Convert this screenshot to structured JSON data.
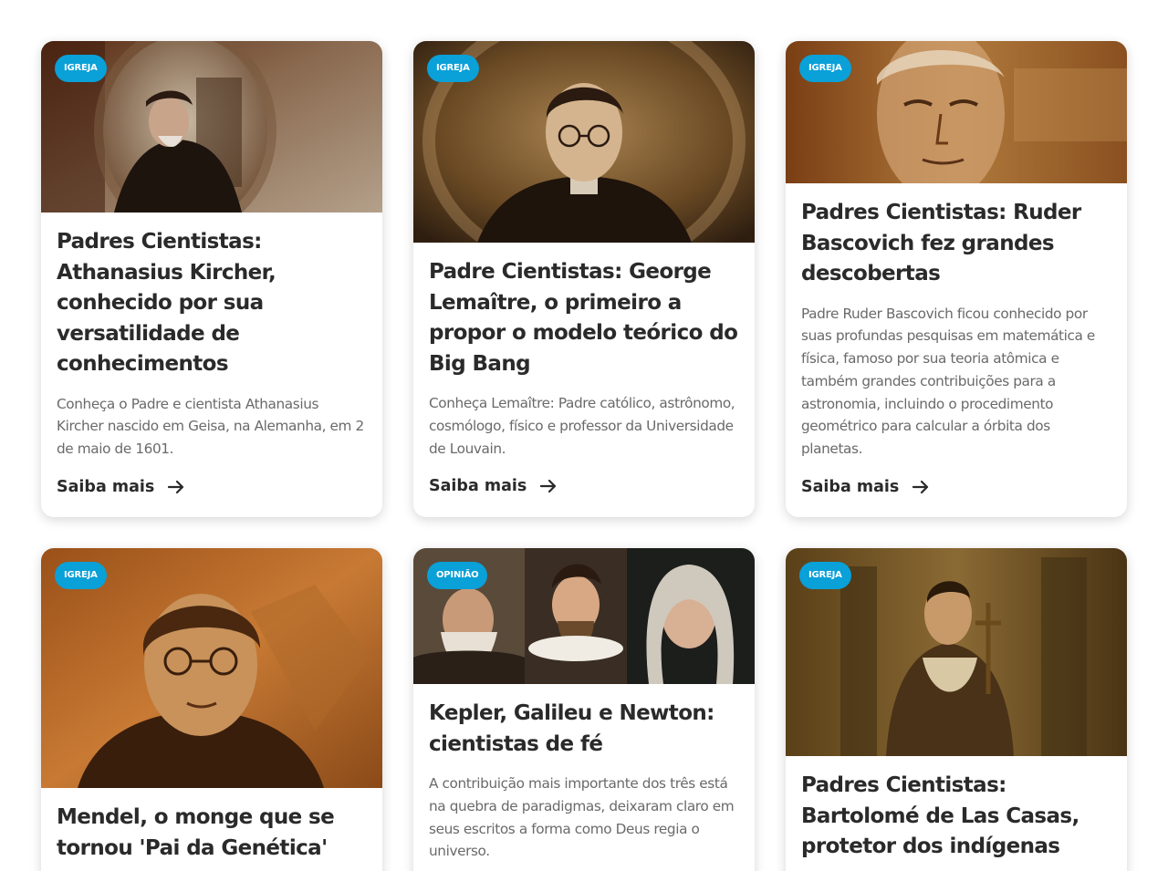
{
  "cards": [
    {
      "badge": "IGREJA",
      "title": "Padres Cientistas: Athanasius Kircher, conhecido por sua versatilidade de conhecimentos",
      "description": "Conheça o Padre e cientista Athanasius Kircher nascido em Geisa, na Alemanha, em 2 de maio de 1601.",
      "link": "Saiba mais",
      "image": "athanasius-kircher-portrait"
    },
    {
      "badge": "IGREJA",
      "title": "Padre Cientistas: George Lemaître, o primeiro a propor o modelo teórico do Big Bang",
      "description": "Conheça Lemaître: Padre católico, astrônomo, cosmólogo, físico e professor da Universidade de Louvain.",
      "link": "Saiba mais",
      "image": "george-lemaitre-portrait"
    },
    {
      "badge": "IGREJA",
      "title": "Padres Cientistas: Ruder Bascovich fez grandes descobertas",
      "description": "Padre Ruder Bascovich ficou conhecido por suas profundas pesquisas em matemática e física, famoso por sua teoria atômica e também grandes contribuições para a astronomia, incluindo o procedimento geométrico para calcular a órbita dos planetas.",
      "link": "Saiba mais",
      "image": "ruder-bascovich-portrait"
    },
    {
      "badge": "IGREJA",
      "title": "Mendel, o monge que se tornou 'Pai da Genética'",
      "description": "",
      "link": "",
      "image": "gregor-mendel-portrait"
    },
    {
      "badge": "OPINIÃO",
      "title": "Kepler, Galileu e Newton: cientistas de fé",
      "description": "A contribuição mais importante dos três está na quebra de paradigmas, deixaram claro em seus escritos a forma como Deus regia o universo.",
      "link": "",
      "image": "kepler-galileu-newton-portraits"
    },
    {
      "badge": "IGREJA",
      "title": "Padres Cientistas: Bartolomé de Las Casas, protetor dos indígenas",
      "description": "",
      "link": "",
      "image": "bartolome-de-las-casas-painting"
    }
  ],
  "colors": {
    "badge": "#0aa0d8",
    "title": "#2a2a2a",
    "description": "#6a6a6a"
  }
}
